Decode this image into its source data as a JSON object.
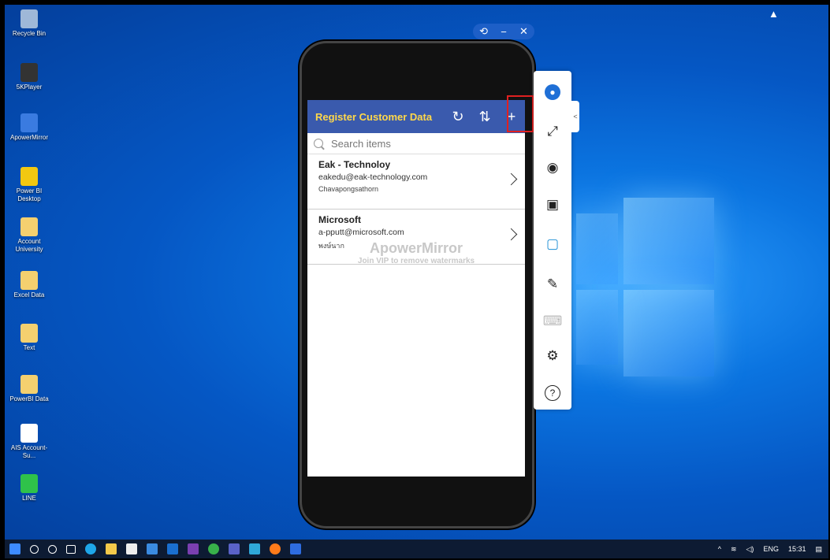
{
  "desktop_icons": [
    {
      "label": "Recycle Bin",
      "icon": "recycle-bin-icon",
      "color": "#9fb8d8"
    },
    {
      "label": "5KPlayer",
      "icon": "panda-icon",
      "color": "#333333"
    },
    {
      "label": "ApowerMirror",
      "icon": "apowermirror-icon",
      "color": "#3a7be0"
    },
    {
      "label": "Power BI Desktop",
      "icon": "powerbi-icon",
      "color": "#f2c811"
    },
    {
      "label": "Account University",
      "icon": "folder-icon",
      "color": "#f4d06f"
    },
    {
      "label": "Excel Data",
      "icon": "folder-icon",
      "color": "#f4d06f"
    },
    {
      "label": "Text",
      "icon": "folder-icon",
      "color": "#f4d06f"
    },
    {
      "label": "PowerBI Data",
      "icon": "folder-icon",
      "color": "#f4d06f"
    },
    {
      "label": "AIS Account-Su...",
      "icon": "file-icon",
      "color": "#ffffff"
    },
    {
      "label": "LINE",
      "icon": "line-icon",
      "color": "#2fc24a"
    }
  ],
  "mirror_window": {
    "controls": [
      "⟲",
      "−",
      "✕"
    ]
  },
  "app": {
    "title": "Register Customer Data",
    "header_buttons": [
      {
        "name": "refresh-button",
        "glyph": "↻"
      },
      {
        "name": "sort-button",
        "glyph": "⇅"
      },
      {
        "name": "add-button",
        "glyph": "+"
      }
    ],
    "search_placeholder": "Search items",
    "items": [
      {
        "title": "Eak - Technoloy",
        "email": "eakedu@eak-technology.com",
        "contact": "Chavapongsathorn"
      },
      {
        "title": "Microsoft",
        "email": "a-pputt@microsoft.com",
        "contact": "พงษ์นาก"
      }
    ]
  },
  "watermark": {
    "brand": "ApowerMirror",
    "note": "Join VIP to remove watermarks"
  },
  "toolbar": {
    "buttons": [
      "avatar-icon",
      "fullscreen-icon",
      "screenshot-icon",
      "record-icon",
      "screen-cast-icon",
      "draw-icon",
      "keyboard-icon",
      "settings-icon",
      "help-icon"
    ],
    "glyphs": [
      "●",
      "⤢",
      "◉",
      "▣",
      "▢",
      "✎",
      "⌨",
      "⚙",
      "?"
    ],
    "collapse": "<"
  },
  "taskbar": {
    "lang": "ENG",
    "time": "15:31"
  }
}
